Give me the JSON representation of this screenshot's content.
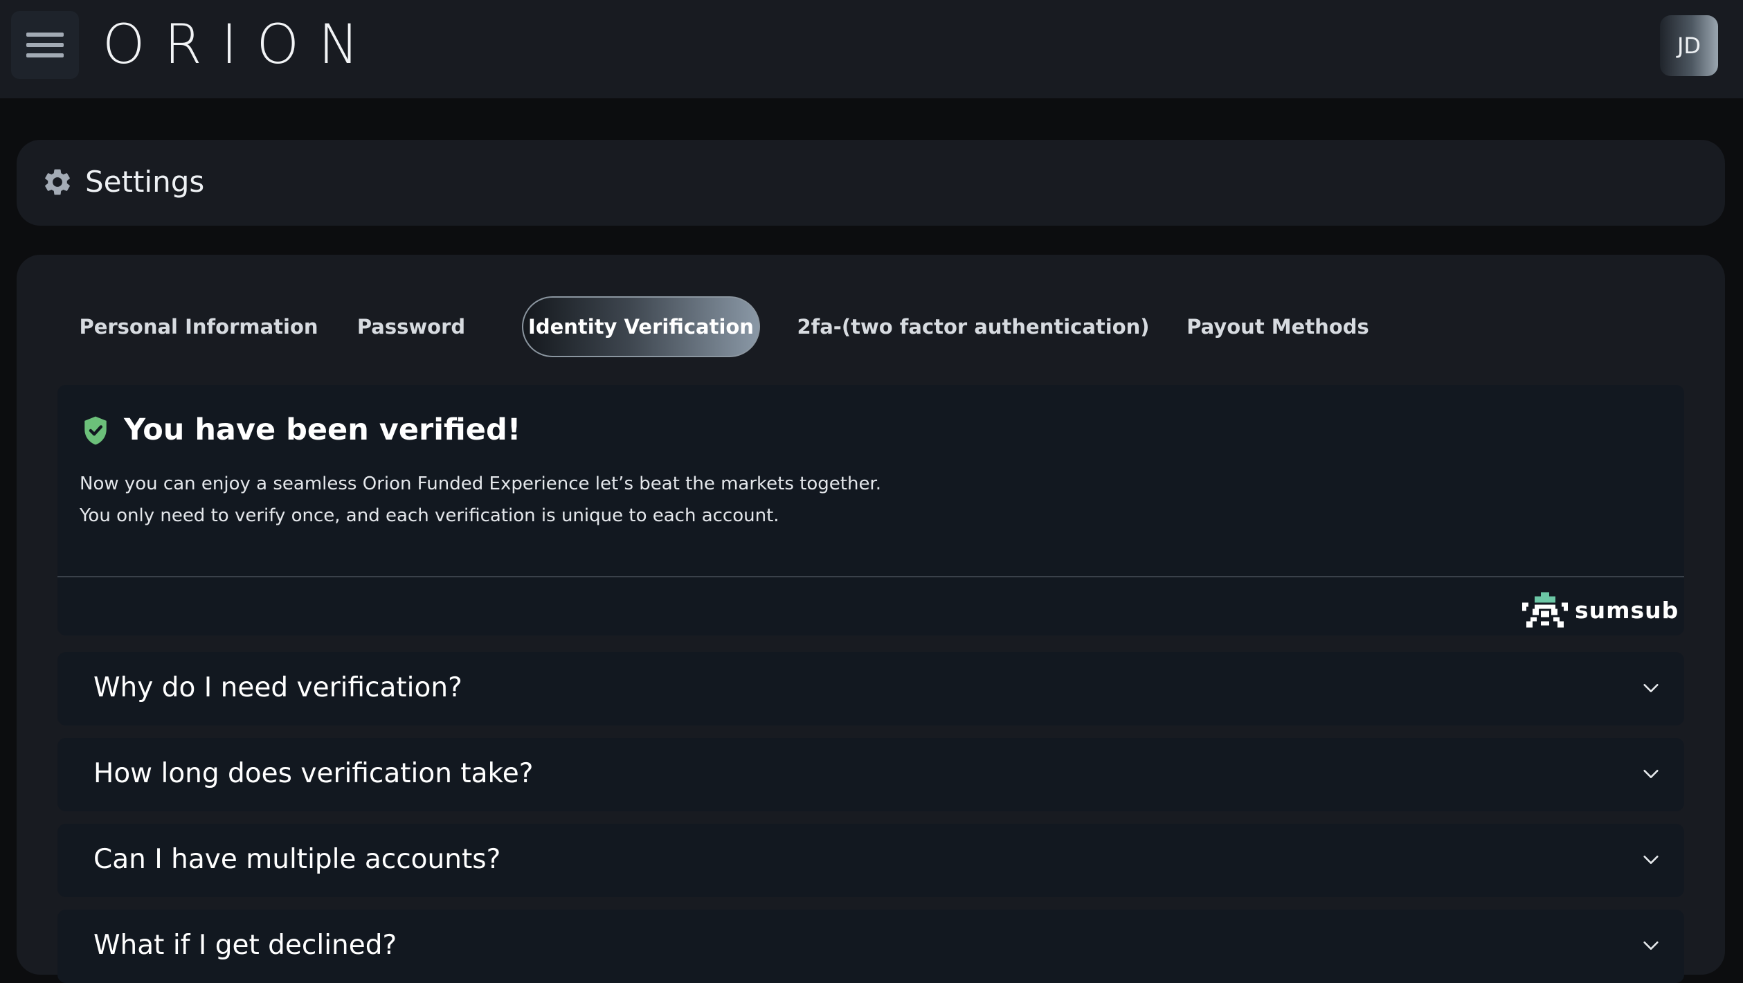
{
  "header": {
    "logo_text": "ORION",
    "avatar_initials": "JD"
  },
  "settings": {
    "title": "Settings"
  },
  "tabs": [
    {
      "label": "Personal Information",
      "active": false
    },
    {
      "label": "Password",
      "active": false
    },
    {
      "label": "Identity Verification",
      "active": true
    },
    {
      "label": "2fa-(two factor authentication)",
      "active": false
    },
    {
      "label": "Payout Methods",
      "active": false
    }
  ],
  "verification": {
    "title": "You have been verified!",
    "line1": "Now you can enjoy a seamless Orion Funded Experience let’s beat the markets together.",
    "line2": "You only need to verify once, and each verification is unique to each account.",
    "provider": "sumsub",
    "status_color": "#6cc07a"
  },
  "faq": [
    {
      "question": "Why do I need verification?"
    },
    {
      "question": "How long does verification take?"
    },
    {
      "question": "Can I have multiple accounts?"
    },
    {
      "question": "What if I get declined?"
    }
  ]
}
